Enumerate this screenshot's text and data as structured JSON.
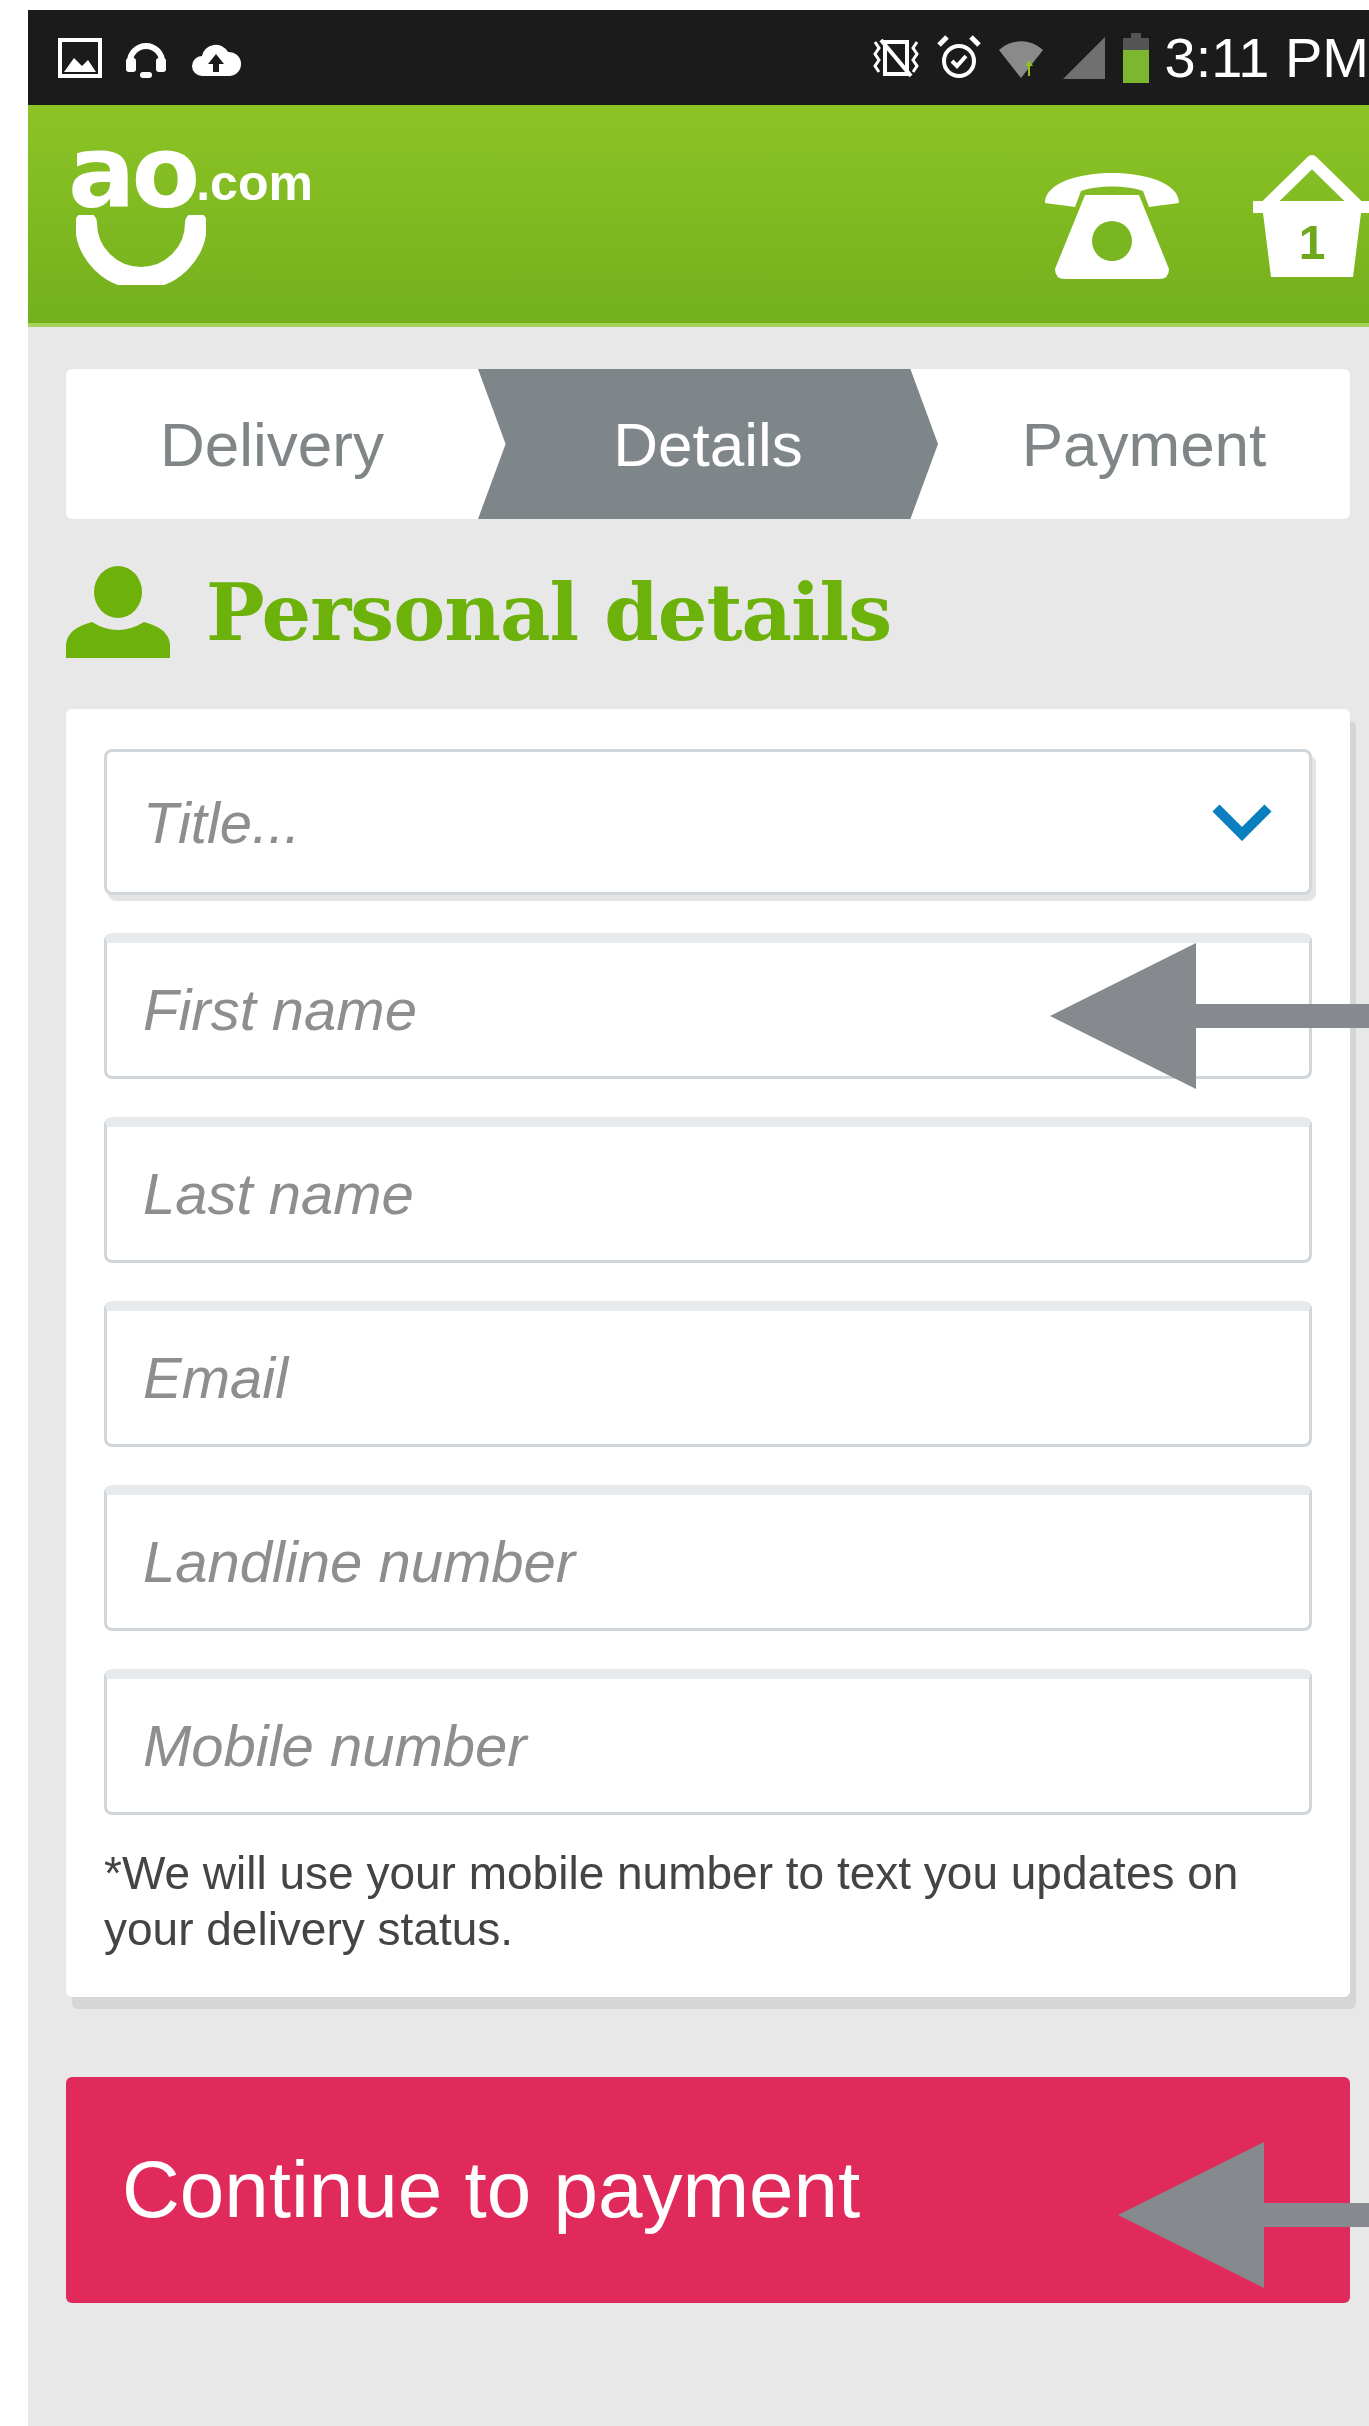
{
  "status_bar": {
    "time": "3:11 PM"
  },
  "header": {
    "logo": {
      "letters": "ao",
      "suffix": ".com"
    },
    "basket_count": "1"
  },
  "steps": [
    {
      "label": "Delivery",
      "selected": false
    },
    {
      "label": "Details",
      "selected": true
    },
    {
      "label": "Payment",
      "selected": false
    }
  ],
  "section": {
    "title": "Personal details"
  },
  "form": {
    "fields": [
      {
        "kind": "select",
        "placeholder": "Title..."
      },
      {
        "kind": "text",
        "placeholder": "First name"
      },
      {
        "kind": "text",
        "placeholder": "Last name"
      },
      {
        "kind": "text",
        "placeholder": "Email"
      },
      {
        "kind": "text",
        "placeholder": "Landline number"
      },
      {
        "kind": "text",
        "placeholder": "Mobile number"
      }
    ],
    "note": "*We will use your mobile number to text you updates on your delivery status."
  },
  "primary_button": {
    "label": "Continue to payment"
  }
}
